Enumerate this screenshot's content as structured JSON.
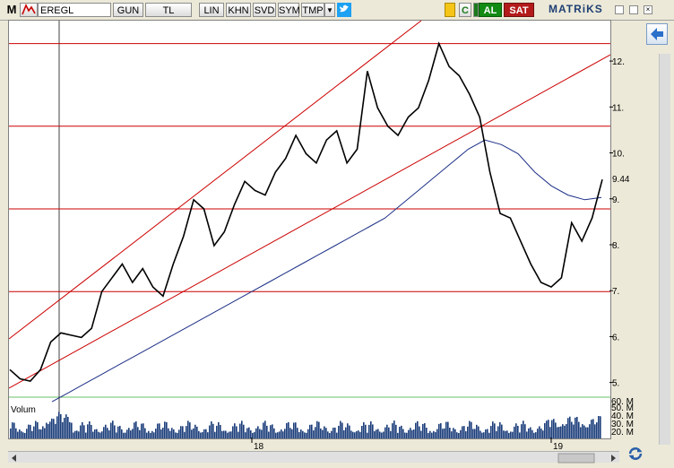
{
  "toolbar": {
    "logo": "M",
    "symbol": "EREGL",
    "buttons": [
      "GUN",
      "TL",
      "LIN",
      "KHN",
      "SVD",
      "SYM",
      "TMP"
    ],
    "buy_label": "AL",
    "sell_label": "SAT",
    "brand": "MATRiKS"
  },
  "chart": {
    "last_price": "9.44",
    "volume_label": "Volum",
    "volume_axis": [
      "60. M",
      "50. M",
      "40. M",
      "30. M",
      "20. M"
    ],
    "x_labels": [
      "18",
      "19"
    ],
    "colors": {
      "price": "#000000",
      "sma": "#1c2f86",
      "hlines": "#cc0000",
      "channel": "#cc0000",
      "volume": "#1a3d7a"
    }
  },
  "chart_data": {
    "type": "line",
    "title": "",
    "y_ticks": [
      5,
      6,
      7,
      8,
      9,
      10,
      11,
      12
    ],
    "ylim": [
      4.7,
      12.9
    ],
    "horizontal_lines": [
      7.0,
      8.8,
      10.6,
      12.4
    ],
    "series": [
      {
        "values": [
          5.3,
          5.1,
          5.05,
          5.3,
          5.9,
          6.1,
          6.05,
          6.0,
          6.2,
          7.0,
          7.3,
          7.6,
          7.2,
          7.5,
          7.1,
          6.9,
          7.6,
          8.2,
          9.0,
          8.8,
          8.0,
          8.3,
          8.9,
          9.4,
          9.2,
          9.1,
          9.6,
          9.9,
          10.4,
          10.0,
          9.8,
          10.3,
          10.5,
          9.8,
          10.1,
          11.8,
          11.0,
          10.6,
          10.4,
          10.8,
          11.0,
          11.6,
          12.4,
          11.9,
          11.7,
          11.3,
          10.8,
          9.6,
          8.7,
          8.6,
          8.1,
          7.6,
          7.2,
          7.1,
          7.3,
          8.5,
          8.1,
          8.6,
          9.44
        ]
      },
      {
        "values": [
          4.6,
          4.8,
          5.0,
          5.2,
          5.4,
          5.6,
          5.8,
          6.0,
          6.2,
          6.4,
          6.6,
          6.8,
          7.0,
          7.2,
          7.4,
          7.6,
          7.8,
          8.0,
          8.2,
          8.4,
          8.6,
          8.9,
          9.2,
          9.5,
          9.8,
          10.1,
          10.3,
          10.2,
          10.0,
          9.6,
          9.3,
          9.1,
          9.0,
          9.05
        ]
      }
    ]
  }
}
